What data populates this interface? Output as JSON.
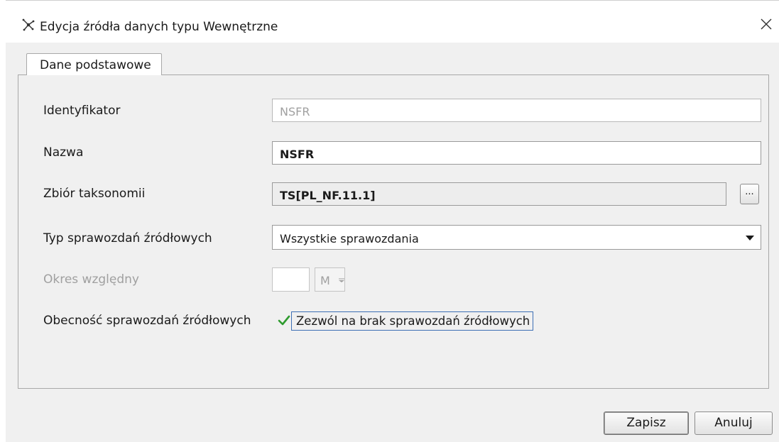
{
  "window": {
    "title": "Edycja źródła danych typu Wewnętrzne",
    "title_icon": "network-nodes-icon",
    "close_icon": "close-icon"
  },
  "tabs": [
    {
      "label": "Dane podstawowe",
      "active": true
    }
  ],
  "form": {
    "identifier": {
      "label": "Identyfikator",
      "value": "NSFR",
      "readonly": true
    },
    "name": {
      "label": "Nazwa",
      "value": "NSFR"
    },
    "taxonomy": {
      "label": "Zbiór taksonomii",
      "value": "TS[PL_NF.11.1]",
      "browse_label": "..."
    },
    "report_type": {
      "label": "Typ sprawozdań źródłowych",
      "selected": "Wszystkie sprawozdania"
    },
    "relative_period": {
      "label": "Okres względny",
      "value": "",
      "unit": "M",
      "disabled": true
    },
    "presence": {
      "label": "Obecność sprawozdań źródłowych",
      "checkbox_label": "Zezwól na brak sprawozdań źródłowych",
      "checked": true
    }
  },
  "buttons": {
    "save": "Zapisz",
    "cancel": "Anuluj"
  },
  "colors": {
    "background": "#f0f0f0",
    "check": "#2e9b2e",
    "focus_border": "#3d6fb5"
  }
}
